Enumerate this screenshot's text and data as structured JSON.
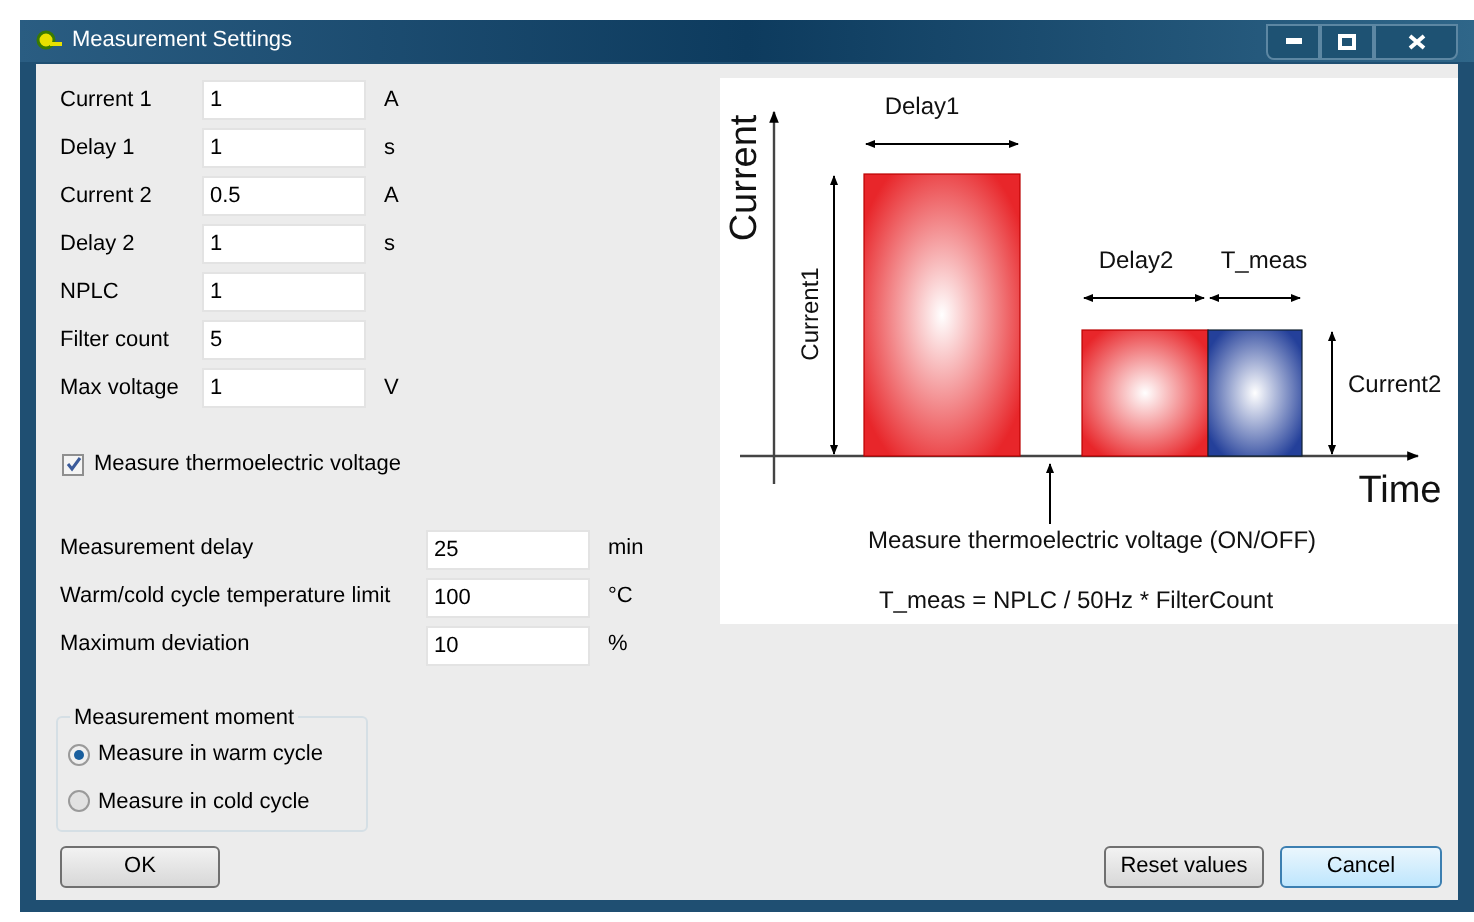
{
  "window": {
    "title": "Measurement Settings"
  },
  "pulse_fields": [
    {
      "label": "Current 1",
      "value": "1",
      "unit": "A"
    },
    {
      "label": "Delay 1",
      "value": "1",
      "unit": "s"
    },
    {
      "label": "Current 2",
      "value": "0.5",
      "unit": "A"
    },
    {
      "label": "Delay 2",
      "value": "1",
      "unit": "s"
    },
    {
      "label": "NPLC",
      "value": "1"
    },
    {
      "label": "Filter count",
      "value": "5"
    },
    {
      "label": "Max voltage",
      "value": "1",
      "unit": "V"
    }
  ],
  "thermo_checkbox": {
    "label": "Measure thermoelectric voltage",
    "checked": true
  },
  "cycle_fields": [
    {
      "label": "Measurement delay",
      "value": "25",
      "unit": "min"
    },
    {
      "label": "Warm/cold cycle temperature limit",
      "value": "100",
      "unit": "°C"
    },
    {
      "label": "Maximum deviation",
      "value": "10",
      "unit": "%"
    }
  ],
  "measurement_moment": {
    "title": "Measurement moment",
    "options": [
      {
        "label": "Measure in warm cycle",
        "selected": true
      },
      {
        "label": "Measure in cold cycle",
        "selected": false
      }
    ]
  },
  "diagram": {
    "y_axis": "Current",
    "x_axis": "Time",
    "delay1": "Delay1",
    "current1": "Current1",
    "delay2": "Delay2",
    "t_meas": "T_meas",
    "current2": "Current2",
    "thermo_note": "Measure thermoelectric voltage (ON/OFF)",
    "formula": "T_meas = NPLC / 50Hz * FilterCount"
  },
  "buttons": {
    "ok": "OK",
    "reset": "Reset values",
    "cancel": "Cancel"
  }
}
